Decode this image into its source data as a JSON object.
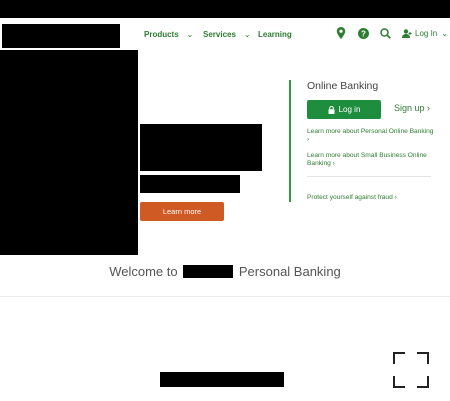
{
  "nav": {
    "products": "Products",
    "services": "Services",
    "learning": "Learning",
    "chevron": "⌄",
    "login": "Log In"
  },
  "hero": {
    "cta": "Learn more"
  },
  "online_banking": {
    "title": "Online Banking",
    "login_button": "Log in",
    "signup": "Sign up ›",
    "link_personal": "Learn more about Personal Online Banking ›",
    "link_small_business": "Learn more about Small Business Online Banking ›",
    "link_fraud": "Protect yourself against fraud ›"
  },
  "welcome": {
    "prefix": "Welcome to",
    "suffix": "Personal Banking"
  },
  "icons": {
    "location": "location-pin-icon",
    "help": "help-icon",
    "search": "search-icon",
    "user": "user-icon",
    "lock": "lock-icon"
  },
  "colors": {
    "brand_green": "#2e7d32",
    "button_green": "#1e8e3e",
    "cta_orange": "#d05a24"
  }
}
